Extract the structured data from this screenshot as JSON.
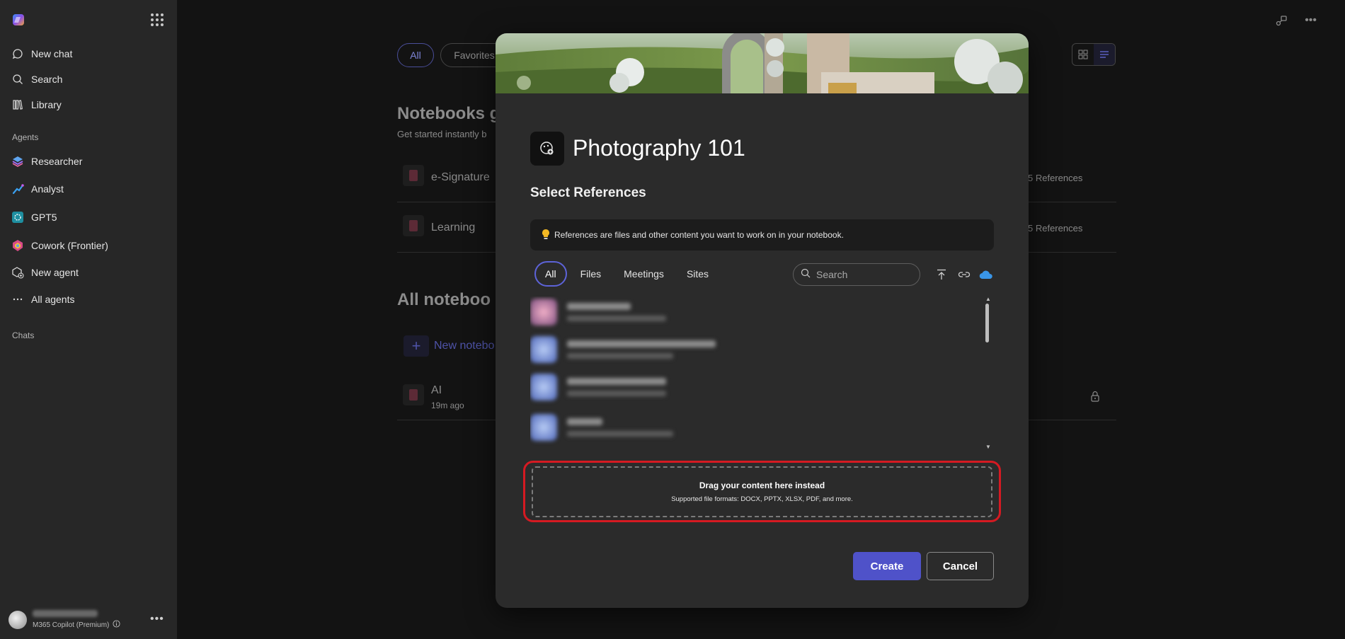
{
  "sidebar": {
    "nav": [
      {
        "label": "New chat",
        "icon": "chat-bubble-icon"
      },
      {
        "label": "Search",
        "icon": "search-icon"
      },
      {
        "label": "Library",
        "icon": "library-icon"
      }
    ],
    "agents_label": "Agents",
    "agents": [
      {
        "label": "Researcher",
        "icon": "researcher-icon"
      },
      {
        "label": "Analyst",
        "icon": "analyst-icon"
      },
      {
        "label": "GPT5",
        "icon": "gpt5-icon"
      },
      {
        "label": "Cowork (Frontier)",
        "icon": "cowork-icon"
      },
      {
        "label": "New agent",
        "icon": "new-agent-icon"
      },
      {
        "label": "All agents",
        "icon": "more-dots-icon"
      }
    ],
    "chats_label": "Chats",
    "user": {
      "plan": "M365 Copilot (Premium)"
    }
  },
  "background": {
    "filters": [
      "All",
      "Favorites"
    ],
    "section_templates_title": "Notebooks g",
    "section_templates_sub": "Get started instantly b",
    "templates": [
      {
        "name": "e-Signature",
        "refs": "5 References"
      },
      {
        "name": "Learning",
        "refs": "5 References"
      }
    ],
    "section_all_title": "All noteboo",
    "new_notebook_label": "New notebo",
    "notebooks": [
      {
        "name": "AI",
        "time": "19m ago"
      }
    ]
  },
  "modal": {
    "title": "Photography 101",
    "subtitle": "Select References",
    "info_text": "References are files and other content you want to work on in your notebook.",
    "tabs": [
      "All",
      "Files",
      "Meetings",
      "Sites"
    ],
    "active_tab": "All",
    "search_placeholder": "Search",
    "drop_title": "Drag your content here instead",
    "drop_sub": "Supported file formats: DOCX, PPTX, XLSX, PDF, and more.",
    "create_label": "Create",
    "cancel_label": "Cancel"
  },
  "colors": {
    "accent": "#4f52c9",
    "highlight": "#d51a22",
    "sidebar_bg": "#272727",
    "modal_bg": "#2b2b2b"
  }
}
